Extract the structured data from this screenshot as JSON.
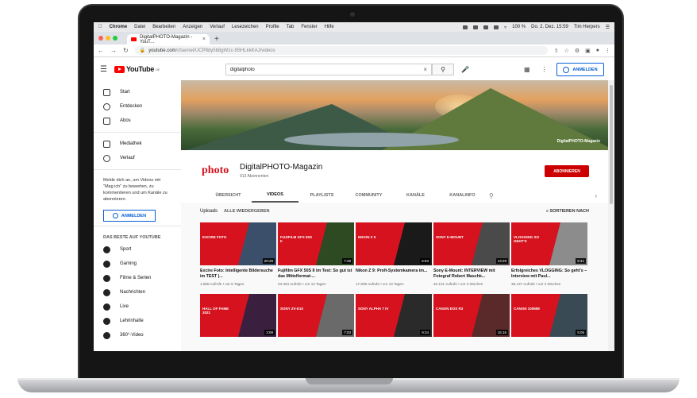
{
  "menubar": {
    "app": "Chrome",
    "items": [
      "Datei",
      "Bearbeiten",
      "Anzeigen",
      "Verlauf",
      "Lesezeichen",
      "Profile",
      "Tab",
      "Fenster",
      "Hilfe"
    ],
    "battery": "100 %",
    "datetime": "Do. 2. Dez.  15:59",
    "user": "Tim Herpers"
  },
  "browser": {
    "tab_title": "DigitalPHOTO-Magazin - YouT...",
    "url_host": "youtube.com",
    "url_path": "/channel/UCP8dy5b8gW1c-9SHLkkKAJ/videos"
  },
  "youtube": {
    "logo_text": "YouTube",
    "logo_region": "DE",
    "search_value": "digitalphoto",
    "signin_label": "ANMELDEN"
  },
  "sidebar": {
    "main": [
      {
        "label": "Start",
        "icon": "home-icon"
      },
      {
        "label": "Entdecken",
        "icon": "compass-icon"
      },
      {
        "label": "Abos",
        "icon": "subscriptions-icon"
      }
    ],
    "library": [
      {
        "label": "Mediathek",
        "icon": "library-icon"
      },
      {
        "label": "Verlauf",
        "icon": "history-icon"
      }
    ],
    "promo": "Melde dich an, um Videos mit \"Mag ich\" zu bewerten, zu kommentieren und um Kanäle zu abonnieren.",
    "signin_label": "ANMELDEN",
    "best_title": "DAS BESTE AUF YOUTUBE",
    "best": [
      {
        "label": "Sport",
        "icon": "sport-icon"
      },
      {
        "label": "Gaming",
        "icon": "gaming-icon"
      },
      {
        "label": "Filme & Serien",
        "icon": "movies-icon"
      },
      {
        "label": "Nachrichten",
        "icon": "news-icon"
      },
      {
        "label": "Live",
        "icon": "live-icon"
      },
      {
        "label": "Lehrinhalte",
        "icon": "learning-icon"
      },
      {
        "label": "360°-Video",
        "icon": "360-icon"
      }
    ]
  },
  "channel": {
    "banner_label": "DigitalPHOTO-Magazin",
    "logo": "photo",
    "name": "DigitalPHOTO-Magazin",
    "subscribers": "913 Abonnenten",
    "subscribe_label": "ABONNIEREN",
    "tabs": [
      "ÜBERSICHT",
      "VIDEOS",
      "PLAYLISTS",
      "COMMUNITY",
      "KANÄLE",
      "KANALINFO"
    ],
    "active_tab": "VIDEOS"
  },
  "filter": {
    "label": "Uploads",
    "all": "ALLE WIEDERGEBEN",
    "sort": "SORTIEREN NACH"
  },
  "videos": [
    {
      "thumb": "EXCIRE FOTO",
      "duration": "20:29",
      "title": "Excire Foto: Intelligente Bildersuche im TEST |...",
      "meta": "1.598 Aufrufe • vor 6 Tagen",
      "bg": "#3b4f6a"
    },
    {
      "thumb": "FUJIFILM GFX 50S II",
      "duration": "7:48",
      "title": "Fujifilm GFX 50S II im Test: So gut ist das Mittelformat-...",
      "meta": "23.304 Aufrufe • vor 13 Tagen",
      "bg": "#2d4a22"
    },
    {
      "thumb": "NIKON Z 9",
      "duration": "6:53",
      "title": "Nikon Z 9: Profi-Systemkamera im...",
      "meta": "17.809 Aufrufe • vor 13 Tagen",
      "bg": "#1a1a1a"
    },
    {
      "thumb": "SONY E-MOUNT",
      "duration": "13:29",
      "title": "Sony E-Mount: INTERVIEW mit Fotograf Robert Maschk...",
      "meta": "40.101 Aufrufe • vor 2 Wochen",
      "bg": "#4a4a4a"
    },
    {
      "thumb": "VLOGGING SO GEHT'S",
      "duration": "9:41",
      "title": "Erfolgreiches VLOGGING: So geht's – Interview mit Paul...",
      "meta": "38.137 Aufrufe • vor 2 Wochen",
      "bg": "#8c8c8c"
    },
    {
      "thumb": "HALL OF FAME 2021",
      "duration": "3:08",
      "title": "",
      "meta": "",
      "bg": "#3b1f3f"
    },
    {
      "thumb": "SONY ZV-E10",
      "duration": "7:03",
      "title": "",
      "meta": "",
      "bg": "#6a6a6a"
    },
    {
      "thumb": "SONY ALPHA 7 IV",
      "duration": "9:34",
      "title": "",
      "meta": "",
      "bg": "#2a2a2a"
    },
    {
      "thumb": "CANON EOS R3",
      "duration": "15:16",
      "title": "",
      "meta": "",
      "bg": "#5a2a2a"
    },
    {
      "thumb": "CANON 100MM",
      "duration": "5:05",
      "title": "",
      "meta": "",
      "bg": "#3a4a55"
    }
  ]
}
